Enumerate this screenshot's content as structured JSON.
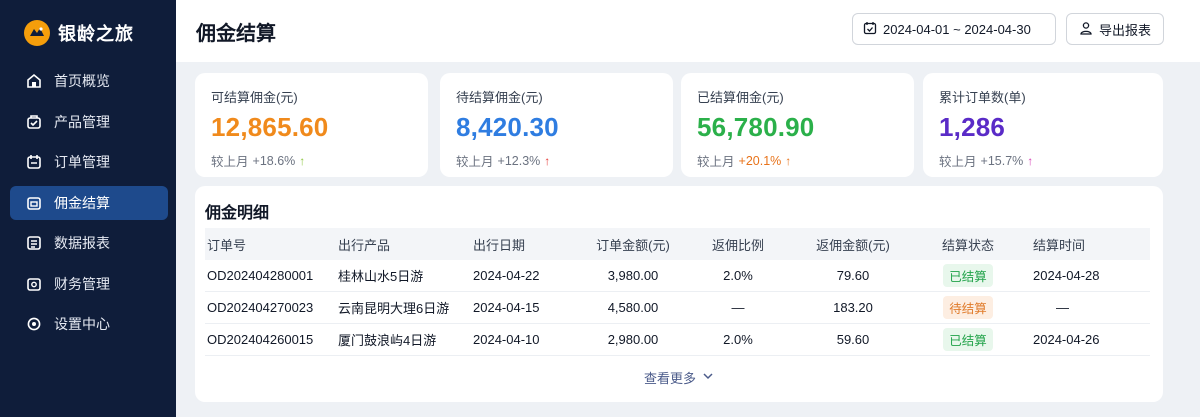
{
  "sidebar": {
    "brand": "银龄之旅",
    "items": [
      {
        "label": "首页概览",
        "icon": "home-icon"
      },
      {
        "label": "产品管理",
        "icon": "product-icon"
      },
      {
        "label": "订单管理",
        "icon": "order-icon"
      },
      {
        "label": "佣金结算",
        "icon": "commission-icon",
        "active": true
      },
      {
        "label": "数据报表",
        "icon": "report-icon"
      },
      {
        "label": "财务管理",
        "icon": "finance-icon"
      },
      {
        "label": "设置中心",
        "icon": "settings-icon"
      }
    ]
  },
  "header": {
    "title": "佣金结算",
    "date_range": "2024-04-01 ~ 2024-04-30",
    "export_label": "导出报表"
  },
  "stats": [
    {
      "label": "可结算佣金(元)",
      "value": "12,865.60",
      "compare": "较上月",
      "delta": "+18.6%",
      "color": "#f08a1c",
      "arrow_color": "#8dc63f"
    },
    {
      "label": "待结算佣金(元)",
      "value": "8,420.30",
      "compare": "较上月",
      "delta": "+12.3%",
      "color": "#2f7de1",
      "arrow_color": "#e53935"
    },
    {
      "label": "已结算佣金(元)",
      "value": "56,780.90",
      "compare": "较上月",
      "delta": "+20.1%",
      "color": "#2bb04a",
      "arrow_color": "#e8731a"
    },
    {
      "label": "累计订单数(单)",
      "value": "1,286",
      "compare": "较上月",
      "delta": "+15.7%",
      "color": "#5a2bc7",
      "arrow_color": "#d63fb5"
    }
  ],
  "detail": {
    "title": "佣金明细",
    "columns": [
      "订单号",
      "出行产品",
      "出行日期",
      "订单金额(元)",
      "返佣比例",
      "返佣金额(元)",
      "结算状态",
      "结算时间"
    ],
    "rows": [
      {
        "order_id": "OD202404280001",
        "product": "桂林山水5日游",
        "date": "2024-04-22",
        "amount": "3,980.00",
        "rate": "2.0%",
        "commission": "79.60",
        "status": "已结算",
        "status_type": "done",
        "settle_time": "2024-04-28"
      },
      {
        "order_id": "OD202404270023",
        "product": "云南昆明大理6日游",
        "date": "2024-04-15",
        "amount": "4,580.00",
        "rate": "—",
        "commission": "183.20",
        "status": "待结算",
        "status_type": "pending",
        "settle_time": "—"
      },
      {
        "order_id": "OD202404260015",
        "product": "厦门鼓浪屿4日游",
        "date": "2024-04-10",
        "amount": "2,980.00",
        "rate": "2.0%",
        "commission": "59.60",
        "status": "已结算",
        "status_type": "done",
        "settle_time": "2024-04-26"
      }
    ],
    "more_label": "查看更多"
  }
}
